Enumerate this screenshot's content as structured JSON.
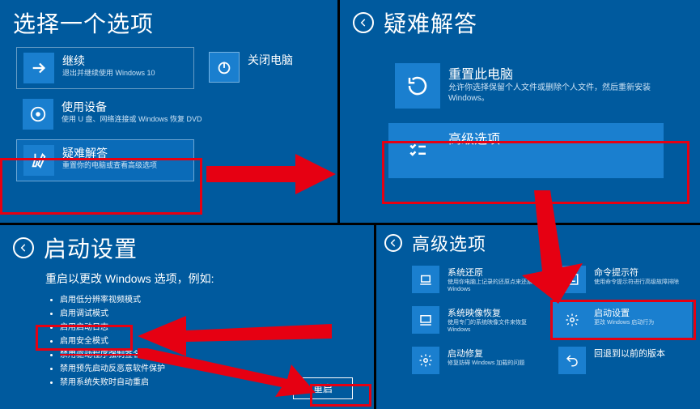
{
  "panel1": {
    "title": "选择一个选项",
    "opts": {
      "continue": {
        "label": "继续",
        "desc": "退出并继续使用 Windows 10"
      },
      "shutdown": {
        "label": "关闭电脑"
      },
      "device": {
        "label": "使用设备",
        "desc": "使用 U 盘、网络连接或 Windows 恢复 DVD"
      },
      "trouble": {
        "label": "疑难解答",
        "desc": "重置你的电脑或查看高级选项"
      }
    }
  },
  "panel2": {
    "title": "疑难解答",
    "opts": {
      "reset": {
        "label": "重置此电脑",
        "desc": "允许你选择保留个人文件或删除个人文件，然后重新安装 Windows。"
      },
      "advanced": {
        "label": "高级选项"
      }
    }
  },
  "panel3": {
    "title": "启动设置",
    "subhead": "重启以更改 Windows 选项，例如:",
    "items": [
      "启用低分辨率视频模式",
      "启用调试模式",
      "启用启动日志",
      "启用安全模式",
      "禁用驱动程序强制签名",
      "禁用预先启动反恶意软件保护",
      "禁用系统失败时自动重启"
    ],
    "restart": "重启"
  },
  "panel4": {
    "title": "高级选项",
    "opts": {
      "restore": {
        "label": "系统还原",
        "desc": "使用你电脑上记录的还原点来还原 Windows"
      },
      "cmd": {
        "label": "命令提示符",
        "desc": "使用命令提示符进行高级故障排除"
      },
      "image": {
        "label": "系统映像恢复",
        "desc": "使用专门的系统映像文件来恢复 Windows"
      },
      "startup": {
        "label": "启动设置",
        "desc": "更改 Windows 启动行为"
      },
      "repair": {
        "label": "启动修复",
        "desc": "修复妨碍 Windows 加载的问题"
      },
      "rollback": {
        "label": "回退到以前的版本"
      }
    }
  }
}
